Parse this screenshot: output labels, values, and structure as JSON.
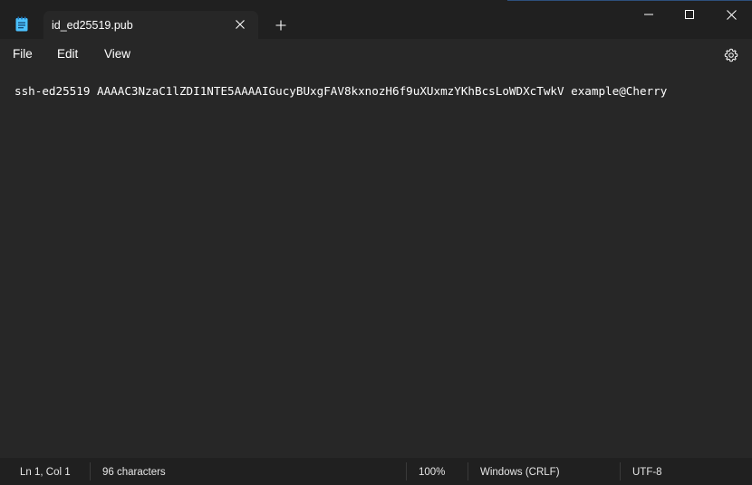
{
  "tab": {
    "title": "id_ed25519.pub"
  },
  "menu": {
    "file": "File",
    "edit": "Edit",
    "view": "View"
  },
  "editor": {
    "content": "ssh-ed25519 AAAAC3NzaC1lZDI1NTE5AAAAIGucyBUxgFAV8kxnozH6f9uXUxmzYKhBcsLoWDXcTwkV example@Cherry"
  },
  "status": {
    "position": "Ln 1, Col 1",
    "characters": "96 characters",
    "zoom": "100%",
    "line_endings": "Windows (CRLF)",
    "encoding": "UTF-8"
  },
  "icons": {
    "app": "notepad-icon",
    "close_tab": "close-icon",
    "new_tab": "plus-icon",
    "minimize": "minimize-icon",
    "maximize": "maximize-icon",
    "close_window": "close-icon",
    "settings": "gear-icon"
  },
  "colors": {
    "background": "#272727",
    "titlebar": "#202020",
    "text": "#ffffff",
    "app_icon": "#4cc2ff"
  }
}
